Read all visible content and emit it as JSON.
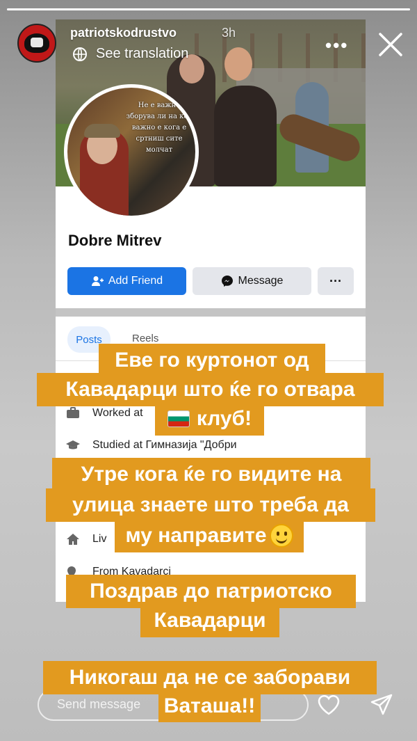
{
  "story": {
    "progress": 1.0,
    "username": "patriotskodrustvo",
    "time": "3h",
    "translate_label": "See translation",
    "more_label": "•••",
    "reply_placeholder": "Send message"
  },
  "facebook": {
    "profile_name": "Dobre Mitrev",
    "profile_photo_text": "Не е важно зборува ли на кое важно е кога е сртниш сите молчат",
    "add_friend_label": "Add Friend",
    "message_label": "Message",
    "more_label": "···",
    "tabs": [
      {
        "label": "Posts",
        "active": true
      },
      {
        "label": "Reels",
        "active": false
      }
    ],
    "intro": [
      {
        "icon": "briefcase-icon",
        "text": "Worked at"
      },
      {
        "icon": "graduation-cap-icon",
        "text": "Studied at Гимназија \"Добри"
      },
      {
        "icon": "home-icon",
        "text": "Liv"
      },
      {
        "icon": "location-pin-icon",
        "text": "From Kavadarci"
      }
    ],
    "accent_color": "#1b74e4"
  },
  "captions": [
    "Еве го куртонот од",
    "Кавадарци што ќе го отвара",
    "клуб!",
    "Утре кога ќе го видите на",
    "улица знаете што треба да",
    "му направите",
    "Поздрав до патриотско",
    "Кавадарци",
    "Никогаш да не се заборави",
    "Ваташа!!"
  ],
  "caption_color": "#e29a1f"
}
